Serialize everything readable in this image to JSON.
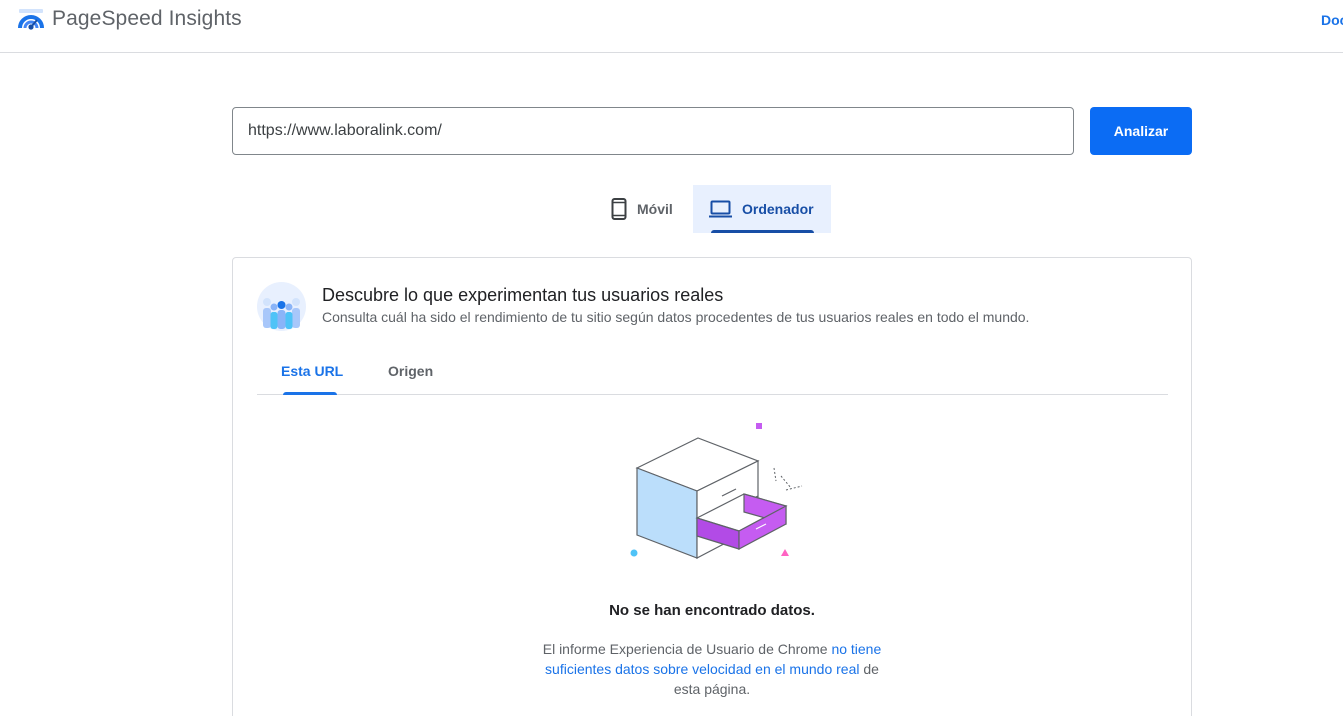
{
  "header": {
    "app_title": "PageSpeed Insights",
    "docs_label": "Doc"
  },
  "search": {
    "url_value": "https://www.laboralink.com/",
    "analyze_label": "Analizar"
  },
  "device_tabs": [
    {
      "label": "Móvil",
      "icon": "smartphone-icon",
      "selected": false
    },
    {
      "label": "Ordenador",
      "icon": "laptop-icon",
      "selected": true
    }
  ],
  "field_data": {
    "icon": "real-users-icon",
    "title": "Descubre lo que experimentan tus usuarios reales",
    "subtitle": "Consulta cuál ha sido el rendimiento de tu sitio según datos procedentes de tus usuarios reales en todo el mundo.",
    "tabs": [
      {
        "label": "Esta URL",
        "selected": true
      },
      {
        "label": "Origen",
        "selected": false
      }
    ],
    "empty_state": {
      "illustration": "empty-drawer-illustration",
      "title": "No se han encontrado datos.",
      "text_before": "El informe Experiencia de Usuario de Chrome ",
      "link_text": "no tiene suficientes datos sobre velocidad en el mundo real",
      "text_after": " de esta página."
    }
  },
  "colors": {
    "primary_button": "#0b6cf4",
    "link": "#1a73e8",
    "selected_tab_bg": "#e8f0fe",
    "selected_tab_text": "#174ea6",
    "drawer_accent": "#c55cf1"
  }
}
